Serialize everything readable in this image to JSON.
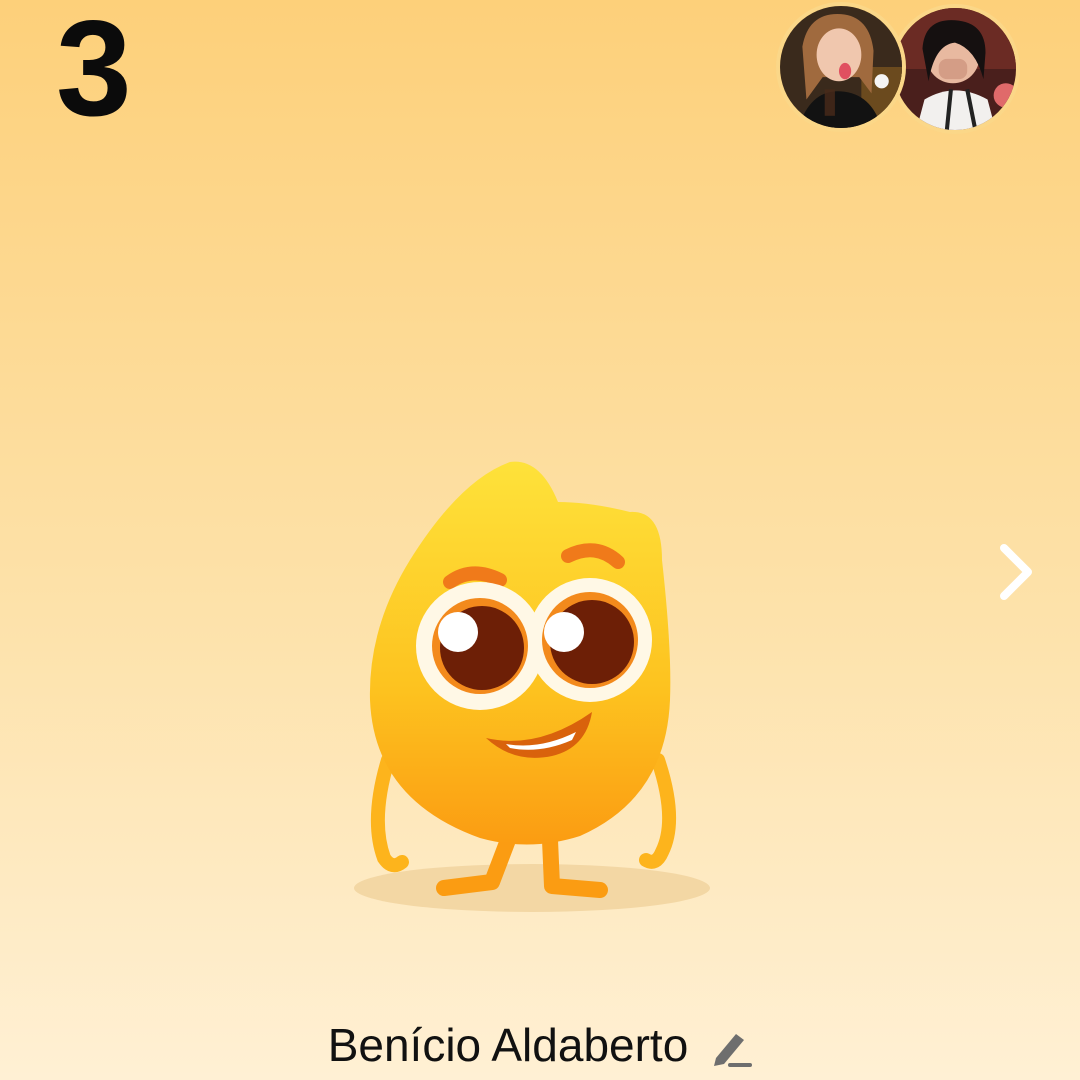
{
  "streak": {
    "count": "3"
  },
  "friends": {
    "avatars": [
      {
        "name": "friend-avatar-1",
        "icon": "photo-avatar"
      },
      {
        "name": "friend-avatar-2",
        "icon": "photo-avatar"
      }
    ]
  },
  "navigation": {
    "next_icon": "chevron-right-icon"
  },
  "mascot": {
    "icon": "yellow-flame-mascot"
  },
  "profile": {
    "name": "Benício Aldaberto",
    "edit_icon": "pencil-icon"
  },
  "colors": {
    "background_top": "#fdd07a",
    "background_bottom": "#fff0d4",
    "mascot_body": "#fdc21f",
    "mascot_accent": "#f07a1a",
    "text": "#111111"
  }
}
